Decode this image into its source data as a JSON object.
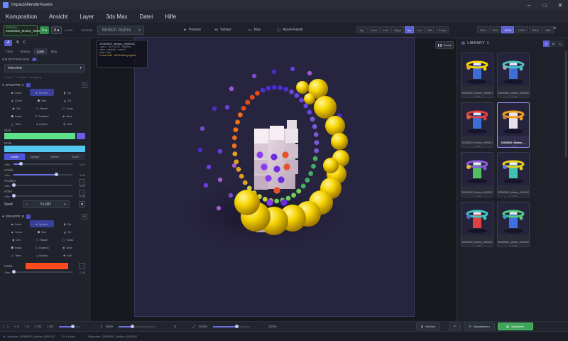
{
  "window": {
    "title": "ImpactAlienderAssets"
  },
  "menu": [
    "Komposition",
    "Ansicht",
    "Layer",
    "3ds Max",
    "Datei",
    "Hilfe"
  ],
  "toolbar": {
    "version_label": "VERSION",
    "version_value": "20260502_Motion_0000012",
    "chip1": "0 ●",
    "chip2": "0 ●",
    "level": "Level",
    "variant_label": "Variante",
    "variant_value": "Motion Alpha",
    "center_buttons": [
      {
        "icon": "✦",
        "label": "Presets"
      },
      {
        "icon": "⟲",
        "label": "Verlauf"
      },
      {
        "icon": "▭",
        "label": "Max"
      },
      {
        "icon": "⬡",
        "label": "Asset-Fabrik"
      }
    ],
    "view_buttons": [
      "Top",
      "Front",
      "Left",
      "Right",
      "Iso",
      "Klz",
      "WA",
      "Persp"
    ],
    "zoom_buttons": [
      "50%",
      "75%",
      "100%",
      "125%",
      "150%",
      "Hilfe"
    ],
    "active_view": "Iso",
    "active_zoom": "100%"
  },
  "left": {
    "top_tabs": [
      "A",
      "B",
      "C"
    ],
    "tabs": [
      "Form",
      "Motion",
      "Look",
      "Max"
    ],
    "active_tab": "Look",
    "group_section": "GRUPPIERUNG",
    "group_badge": "0",
    "group_dropdown": "Interview",
    "hint": "Gruppe 1 · Gruppe 2 · Bewegung",
    "group_a": {
      "title": "GRUPPE A",
      "shapes": [
        "Cube",
        "Sphere",
        "Cyl",
        "Cone",
        "Hex",
        "Tri",
        "Oct",
        "Raute",
        "Torus",
        "Icosa",
        "Dodeca",
        "Octa",
        "Tetra",
        "Pyram",
        "Kell"
      ],
      "active_shape": "Sphere",
      "start_label": "Start",
      "start_color": "#5fe08a",
      "end_label": "Ende",
      "end_color": "#53c8ee",
      "modes": [
        "Linear",
        "Spiegel",
        "Wellen",
        "Zufall"
      ],
      "active_mode": "Linear",
      "jitter_label": "Jitter",
      "jitter_value": "0.10",
      "jitter_fraction": 0.12,
      "size_label": "Größe",
      "size_jitter_label": "Jitter",
      "size_value": "0.40",
      "size_fraction": 0.72,
      "pos_label": "Position",
      "pos_jitter_label": "Jitter",
      "pos_value": "0.00",
      "pos_fraction": 0.0,
      "height_label": "Höhe",
      "height_jitter_label": "Jitter",
      "height_value": "0.00",
      "height_fraction": 0.0,
      "seed_label": "Seed",
      "seed_value": "51.687"
    },
    "group_b": {
      "title": "GRUPPE B",
      "shapes": [
        "Cube",
        "Sphere",
        "Cyl",
        "Cone",
        "Hex",
        "Tri",
        "Oct",
        "Raute",
        "Torus",
        "Icosa",
        "Dodeca",
        "Octa",
        "Tetra",
        "Pyram",
        "Kell"
      ],
      "active_shape": "Sphere",
      "color_label": "Farbe",
      "color": "#ff4a1c",
      "jitter_label": "Jitter",
      "jitter_value": "0.00",
      "jitter_fraction": 0.0
    }
  },
  "viewport": {
    "info_title": "20260502_Motion_0000012",
    "info_lines": [
      "Layer A · 36 × 14/16 · Tabelle to",
      "prime = enabled - wave et",
      "static / 4pts"
    ],
    "info_warning": "2 Layer aktiv · 98 Primitive gruppiert",
    "pause_label": "Pause",
    "ring_colors": [
      "#4b2ed0",
      "#6a44e0",
      "#7a5ad8",
      "#46b060",
      "#74d05a",
      "#c8d040",
      "#e0a020",
      "#f07018",
      "#e84a14"
    ],
    "accent_yellow": "#f6d400"
  },
  "library": {
    "title": "LIBRARY",
    "count": "8",
    "toggles": [
      "S",
      "M",
      "L"
    ],
    "active_toggle": "S",
    "items": [
      {
        "name": "20260502_Motion_0000013",
        "actions": "◐ ◎ ⊕",
        "theme": "yellow-blue"
      },
      {
        "name": "20260502_Motion_0000013",
        "actions": "◐ ◎ ⊕",
        "theme": "teal-blue"
      },
      {
        "name": "20260502_Motion_0000013",
        "actions": "◐ ◎ ⊕",
        "theme": "red-blue"
      },
      {
        "name": "20260502_Motion_...",
        "actions": "◐ ◎ ⊕",
        "theme": "orange-white"
      },
      {
        "name": "20260502_Motion_0000013",
        "actions": "◐ ◎ ⊕",
        "theme": "purple-green"
      },
      {
        "name": "20260502_Motion_0000013",
        "actions": "◐ ◎ ⊕",
        "theme": "yellow-teal"
      },
      {
        "name": "20260502_Motion_0000013",
        "actions": "◐ ◎ ⊕",
        "theme": "teal-red"
      },
      {
        "name": "20260502_Motion_0000013",
        "actions": "◐ ◎ ⊕",
        "theme": "green-blue"
      }
    ],
    "selected_index": 3
  },
  "bottom": {
    "frame": "1",
    "timecodes": [
      "< 0",
      "> 0",
      "< 00",
      "> 00"
    ],
    "hoehe_label": "Höhe",
    "hoehe_value": "0",
    "hoehe_fraction": 0.35,
    "groesse_label": "Größe",
    "groesse_value": "100%",
    "groesse_fraction": 0.62,
    "btn_dice": "Würfeln",
    "btn_refresh": "Aktualisieren",
    "btn_save": "Speichern"
  },
  "status": {
    "variant": "Variante: 20260502_Motion_0000012",
    "level": "33 s Level",
    "target": "Zielordner: 20260502_Motion_0000012"
  }
}
